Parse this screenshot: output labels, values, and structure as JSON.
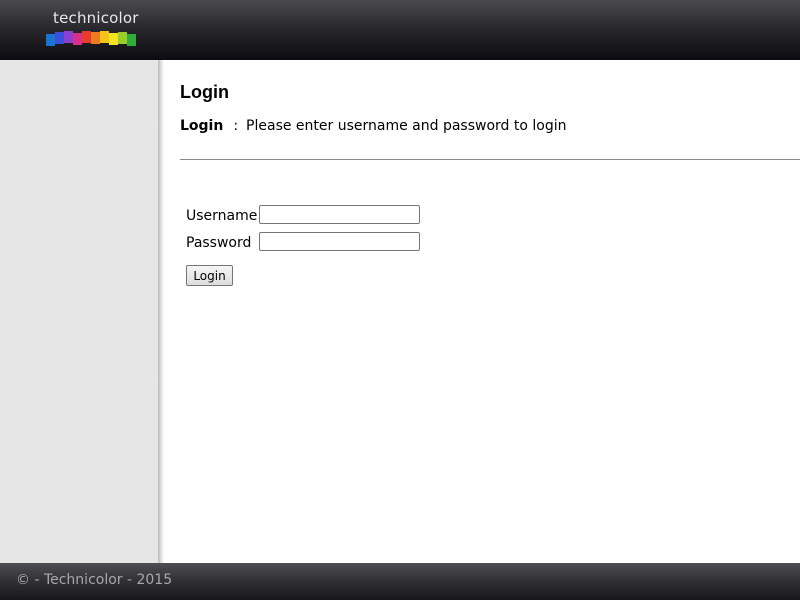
{
  "header": {
    "logo_text": "technicolor",
    "logo_colors": [
      "#1a75d2",
      "#3b4fd8",
      "#8a3fd0",
      "#d8308a",
      "#e83a2e",
      "#f07a1e",
      "#f7c21a",
      "#f2e41e",
      "#9ccc2a",
      "#2fae3a"
    ]
  },
  "main": {
    "title": "Login",
    "subtitle_label": "Login",
    "subtitle_separator": ":",
    "subtitle_text": "Please enter username and password to login",
    "form": {
      "username_label": "Username",
      "username_value": "",
      "password_label": "Password",
      "password_value": "",
      "login_button": "Login"
    }
  },
  "footer": {
    "text": "© - Technicolor - 2015"
  }
}
